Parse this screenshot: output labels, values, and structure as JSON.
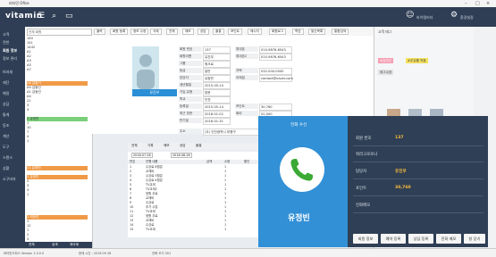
{
  "window": {
    "title": "비타민 Ofice"
  },
  "app": {
    "logo": "vitamin",
    "top_right": [
      "바이템비타",
      "환경설정"
    ]
  },
  "nav": {
    "items": [
      "고객",
      "전반",
      "회원 정보",
      "정보 관리",
      "비과세",
      "재단",
      "메일",
      "상담",
      "통계",
      "동조",
      "계산",
      "도구",
      "스탠스",
      "상황",
      "소구바자"
    ]
  },
  "list": {
    "search_placeholder": "전체 회원",
    "rows": [
      "140",
      "141",
      "1442",
      "A1",
      "A2",
      "A3",
      "A5",
      "A7",
      "A8",
      "A9",
      "A1",
      "A4",
      "21",
      "3",
      "4",
      "2",
      "1",
      "10",
      "7",
      "4",
      "1",
      "11",
      "1",
      "2",
      "3",
      "4",
      "1",
      "2",
      "1",
      "12",
      "1",
      "2",
      "3",
      "4",
      "5",
      "6",
      "7",
      "8",
      "9"
    ],
    "names": [
      "",
      "",
      "",
      "",
      "",
      "",
      "",
      "",
      "김동기",
      "김동선",
      "김동건",
      "",
      "",
      "",
      "",
      "유정빈",
      "",
      "",
      "",
      "",
      "",
      "유정빈",
      "유정빈",
      "",
      "",
      "",
      "",
      "최정연",
      "",
      "",
      "",
      "",
      "",
      "",
      "",
      "",
      "",
      "",
      ""
    ],
    "footer": [
      "전체",
      "검색",
      "재삭제"
    ]
  },
  "toolbar": [
    "출력",
    "회원 등록",
    "정보 수정",
    "삭제",
    "전체",
    "메모",
    "상담",
    "출결",
    "포인트",
    "메시지",
    "회원로그",
    "학업",
    "발신목록",
    "통합검색"
  ],
  "profile": {
    "photo_name": "유진우",
    "fields": [
      {
        "label": "회원 번호",
        "value": "137"
      },
      {
        "label": "회원이름",
        "value": "유진우"
      },
      {
        "label": "그룹",
        "value": "워크로"
      },
      {
        "label": "등급",
        "value": "일반"
      },
      {
        "label": "담당자",
        "value": "유정빈"
      },
      {
        "label": "생년월일",
        "value": "2015-05-14"
      },
      {
        "label": "가입 유형",
        "value": "방문"
      },
      {
        "label": "학교",
        "value": "인천"
      },
      {
        "label": "등록일",
        "value": "2015-05-14"
      },
      {
        "label": "최근 방문",
        "value": "2018-01-02"
      },
      {
        "label": "만기일",
        "value": "2018-01-31"
      },
      {
        "label": "주소",
        "value": "(우) 인천광역시 부평구"
      }
    ],
    "contacts": [
      {
        "label": "휴대폰",
        "value": "010-9876-6543"
      },
      {
        "label": "휴대폰2",
        "value": "010-9876-6543"
      },
      {
        "label": "자택",
        "value": "032-000-0000"
      },
      {
        "label": "이메일",
        "value": "contact@naver.com"
      },
      {
        "label": "포인트",
        "value": "30,760"
      },
      {
        "label": "회비",
        "value": "52,000"
      }
    ]
  },
  "right_panel": {
    "title": "고객 태그",
    "tags": [
      "#김민선",
      "#우유를 먹음",
      "태그수정"
    ]
  },
  "lower": {
    "tabs": [
      "전체",
      "기록",
      "메모",
      "상담",
      "출결"
    ],
    "date_from": "2018-07-28",
    "date_to": "2018-08-28",
    "headers": [
      "번호",
      "진행 내용",
      "금액",
      "수량",
      "할인"
    ],
    "rows": [
      [
        "1",
        "수강료 6월분",
        "",
        "1",
        ""
      ],
      [
        "2",
        "교재비",
        "",
        "1",
        ""
      ],
      [
        "3",
        "수강료 5월분",
        "",
        "1",
        ""
      ],
      [
        "4",
        "수강료 4월분",
        "",
        "1",
        ""
      ],
      [
        "5",
        "TV교재",
        "",
        "1",
        ""
      ],
      [
        "6",
        "TV교재2",
        "",
        "1",
        ""
      ],
      [
        "7",
        "정원 무료",
        "",
        "1",
        ""
      ],
      [
        "8",
        "교재비",
        "",
        "1",
        ""
      ],
      [
        "9",
        "수강료",
        "",
        "1",
        ""
      ],
      [
        "10",
        "추가 수업",
        "",
        "1",
        ""
      ],
      [
        "11",
        "TV교재",
        "",
        "1",
        ""
      ],
      [
        "12",
        "정원 무료",
        "",
        "1",
        ""
      ],
      [
        "13",
        "교재비",
        "",
        "1",
        ""
      ],
      [
        "14",
        "수강료",
        "",
        "1",
        ""
      ],
      [
        "15",
        "TV교재",
        "",
        "1",
        ""
      ]
    ]
  },
  "popup": {
    "title": "전화 수신",
    "caller": "유정빈",
    "info": [
      {
        "label": "회원 번호",
        "value": "137"
      },
      {
        "label": "워라고로로니",
        "value": ""
      },
      {
        "label": "담당자",
        "value": "유진우"
      },
      {
        "label": "포인트",
        "value": "30,760"
      },
      {
        "label": "전화메모",
        "value": ""
      }
    ],
    "buttons": [
      "회원 정보",
      "예약 등록",
      "상담 등록",
      "전화 메모",
      "창 닫기"
    ]
  },
  "status": [
    "비타민오피스 Version 1.0.0.0",
    "현재 시간 : 2018 09 28",
    "전화 오기 001"
  ]
}
